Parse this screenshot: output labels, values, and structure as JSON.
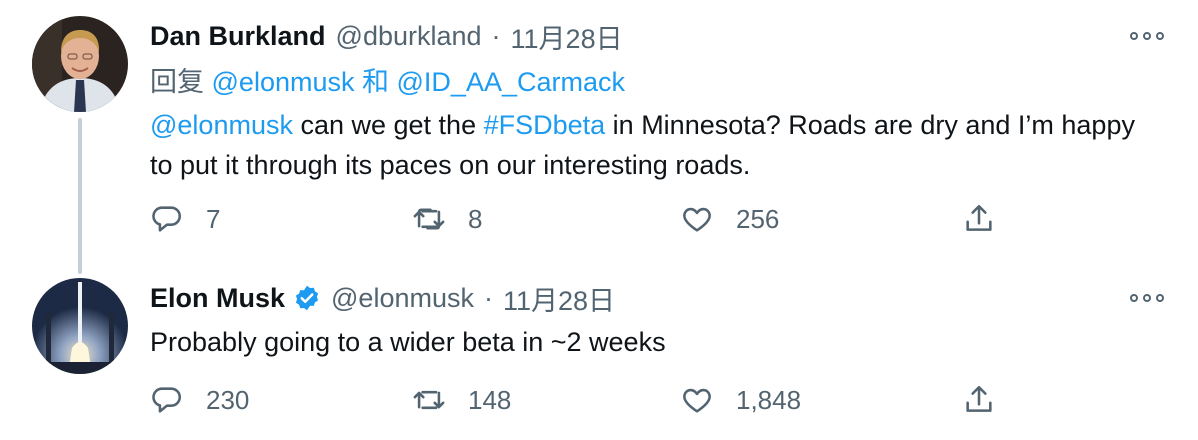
{
  "tweets": [
    {
      "author_name": "Dan Burkland",
      "handle": "@dburkland",
      "separator": "·",
      "time": "11月28日",
      "verified": false,
      "reply_prefix": "回复",
      "reply_user_1": "@elonmusk",
      "reply_conjunction": "和",
      "reply_user_2": "@ID_AA_Carmack",
      "text_mention": "@elonmusk",
      "text_part_1": " can we get the ",
      "text_hashtag": "#FSDbeta",
      "text_part_2": " in Minnesota? Roads are dry and I’m happy to put it through its paces on our interesting roads.",
      "replies": "7",
      "retweets": "8",
      "likes": "256",
      "icons": [
        "more-icon",
        "reply-icon",
        "retweet-icon",
        "like-icon",
        "share-icon"
      ]
    },
    {
      "author_name": "Elon Musk",
      "handle": "@elonmusk",
      "separator": "·",
      "time": "11月28日",
      "verified": true,
      "text": "Probably going to a wider beta in ~2 weeks",
      "replies": "230",
      "retweets": "148",
      "likes": "1,848",
      "icons": [
        "verified-badge-icon",
        "more-icon",
        "reply-icon",
        "retweet-icon",
        "like-icon",
        "share-icon"
      ]
    }
  ],
  "colors": {
    "link": "#1d9bf0",
    "secondary_text": "#536471",
    "primary_text": "#0f1419",
    "thread_line": "#c4cfd6",
    "verified_badge": "#1d9bf0"
  }
}
